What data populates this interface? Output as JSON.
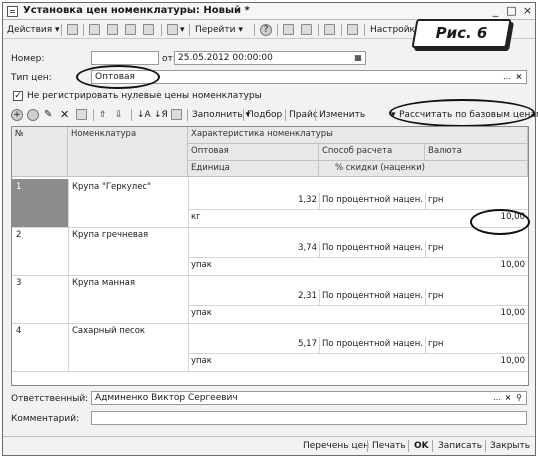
{
  "window": {
    "title": "Установка цен номенклатуры: Новый *",
    "controls": [
      "_",
      "□",
      "×"
    ]
  },
  "toolbar": {
    "actions_label": "Действия",
    "goto_label": "Перейти",
    "settings_label": "Настройк"
  },
  "caption": "Рис. 6",
  "form": {
    "number_label": "Номер:",
    "number_value": "",
    "date_label": "от:",
    "date_value": "25.05.2012 00:00:00",
    "price_type_label": "Тип цен:",
    "price_type_value": "Оптовая",
    "checkbox_label": "Не регистрировать нулевые цены номенклатуры",
    "checkbox_mark": "✓"
  },
  "table_toolbar": {
    "fill_label": "Заполнить",
    "pick_label": "Подбор",
    "price_list_label": "Прайс",
    "change_label": "Изменить",
    "calc_label": "Рассчитать по базовым ценам"
  },
  "table": {
    "headers": {
      "num": "№",
      "item": "Номенклатура",
      "characteristic": "Характеристика номенклатуры",
      "price_type": "Оптовая",
      "calc_method": "Способ расчета",
      "currency": "Валюта",
      "unit": "Единица",
      "discount": "% скидки (наценки)"
    },
    "rows": [
      {
        "num": "1",
        "item": "Крупа \"Геркулес\"",
        "price": "1,32",
        "method": "По процентной нацен...",
        "currency": "грн",
        "unit": "кг",
        "discount": "10,00"
      },
      {
        "num": "2",
        "item": "Крупа гречневая",
        "price": "3,74",
        "method": "По процентной нацен...",
        "currency": "грн",
        "unit": "упак",
        "discount": "10,00"
      },
      {
        "num": "3",
        "item": "Крупа манная",
        "price": "2,31",
        "method": "По процентной нацен...",
        "currency": "грн",
        "unit": "упак",
        "discount": "10,00"
      },
      {
        "num": "4",
        "item": "Сахарный песок",
        "price": "5,17",
        "method": "По процентной нацен...",
        "currency": "грн",
        "unit": "упак",
        "discount": "10,00"
      }
    ]
  },
  "footer": {
    "responsible_label": "Ответственный:",
    "responsible_value": "Админенко Виктор Сергеевич",
    "comment_label": "Комментарий:",
    "comment_value": ""
  },
  "bottom": {
    "price_list": "Перечень цен",
    "print": "Печать",
    "ok": "OK",
    "save": "Записать",
    "close": "Закрыть"
  },
  "colors": {
    "selected_row_cell": "#8c8c8c",
    "header_bg": "#e8e8e8"
  }
}
